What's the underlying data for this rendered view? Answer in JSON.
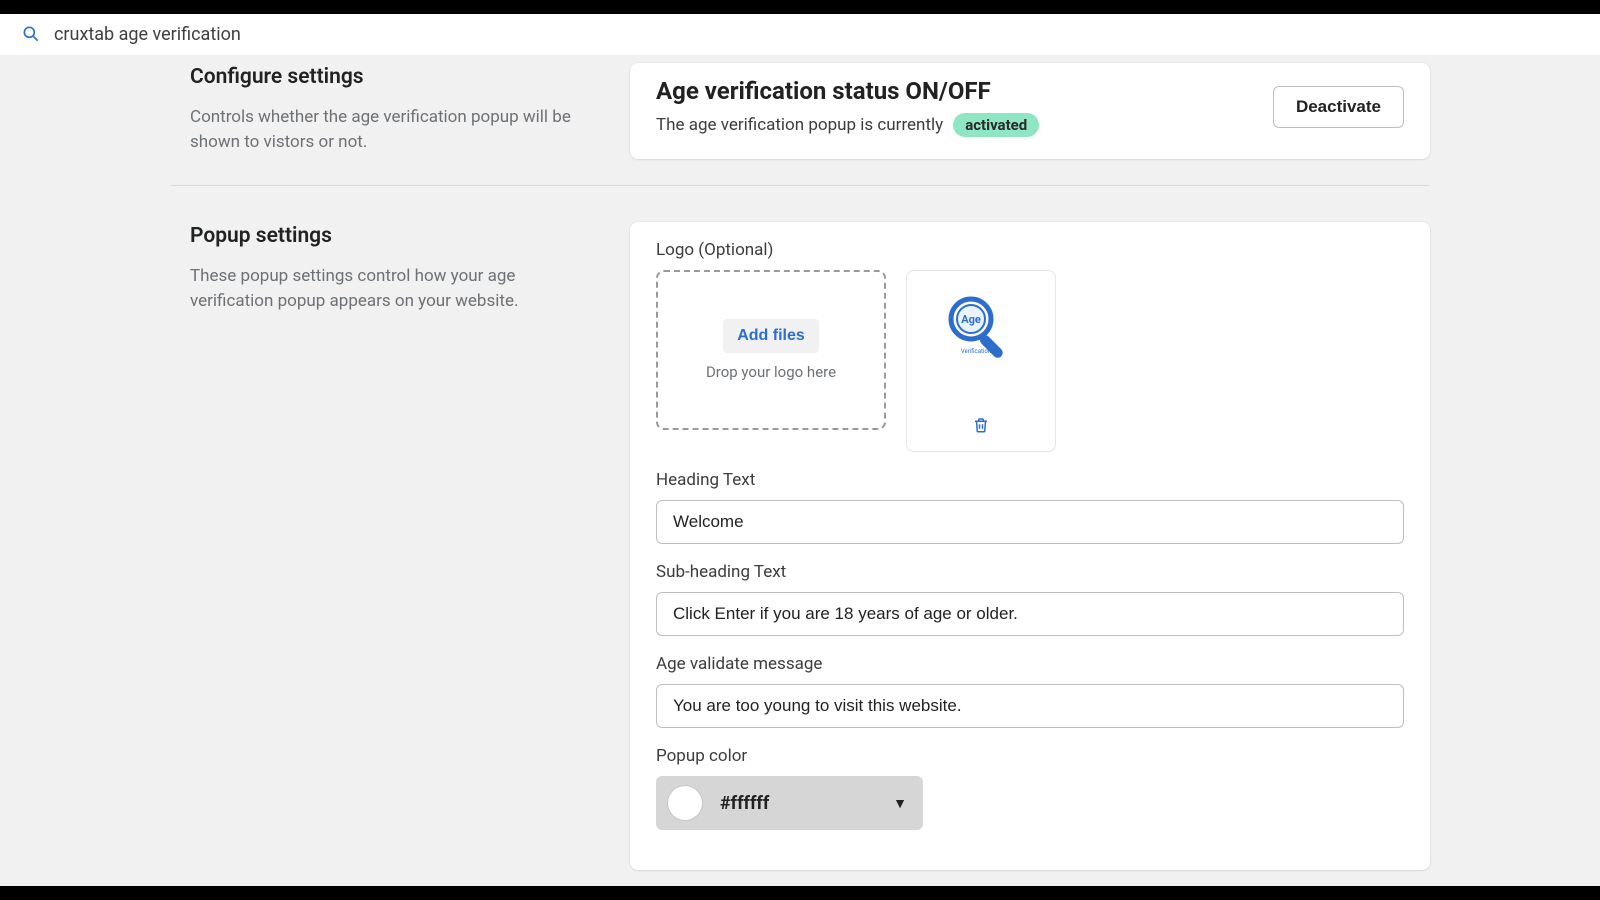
{
  "header": {
    "title": "cruxtab age verification"
  },
  "sections": {
    "configure": {
      "title": "Configure settings",
      "desc": "Controls whether the age verification popup will be shown to vistors or not."
    },
    "popup": {
      "title": "Popup settings",
      "desc": "These popup settings control how your age verification popup appears on your website."
    }
  },
  "status_card": {
    "title": "Age verification status ON/OFF",
    "text": "The age verification popup is currently",
    "badge": "activated",
    "button": "Deactivate"
  },
  "fields": {
    "logo_label": "Logo (Optional)",
    "add_files": "Add files",
    "drop_hint": "Drop your logo here",
    "logo_art_badge": "Age",
    "logo_art_caption": "Verification",
    "heading_label": "Heading Text",
    "heading_value": "Welcome",
    "subheading_label": "Sub-heading Text",
    "subheading_value": "Click Enter if you are 18 years of age or older.",
    "validate_label": "Age validate message",
    "validate_value": "You are too young to visit this website.",
    "popup_color_label": "Popup color",
    "popup_color_value": "#ffffff"
  },
  "colors": {
    "popup_color_swatch": "#ffffff"
  }
}
